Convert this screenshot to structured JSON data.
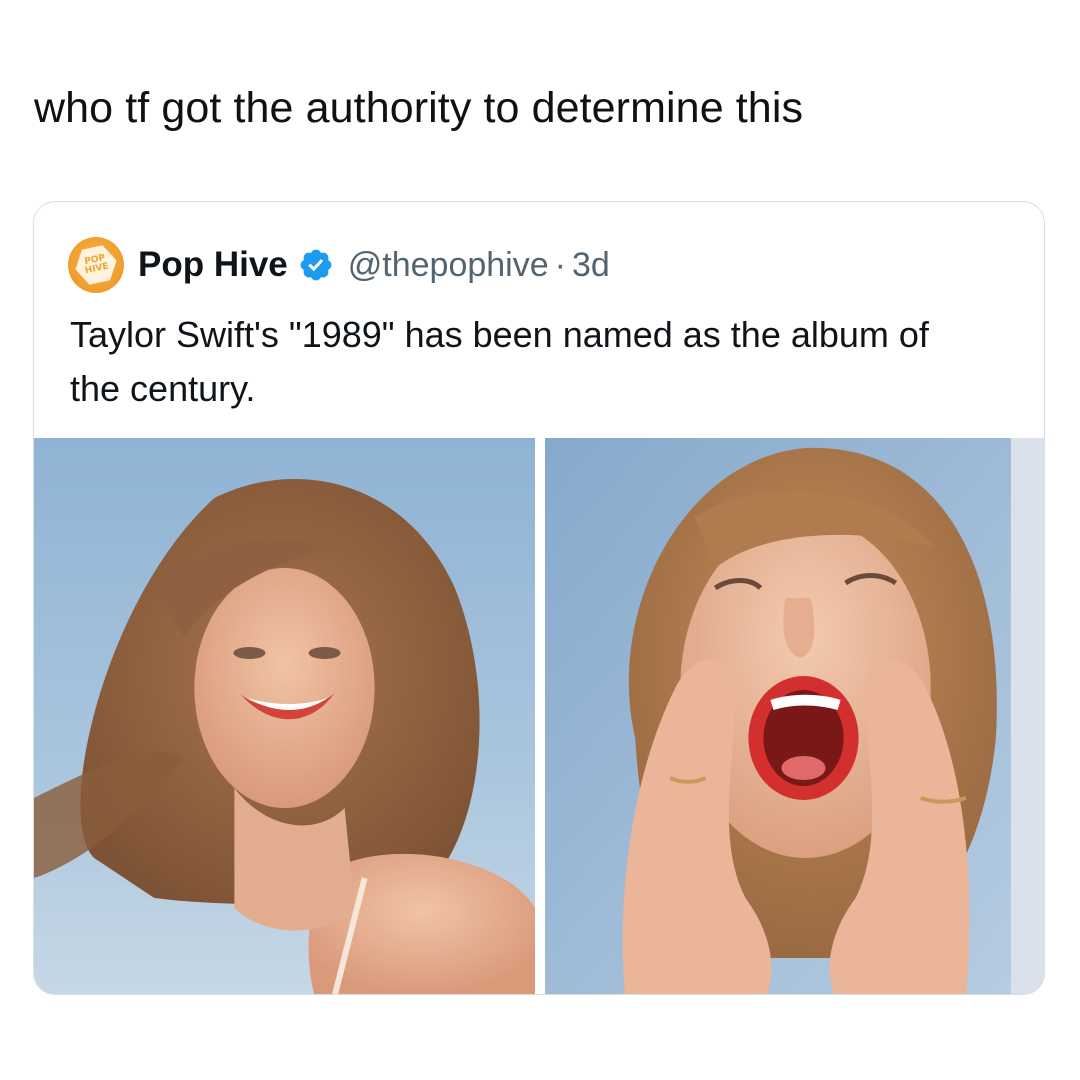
{
  "caption": "who tf got the authority to determine this",
  "quoted_tweet": {
    "avatar_text": [
      "POP",
      "HIVE"
    ],
    "display_name": "Pop Hive",
    "verified": true,
    "handle": "@thepophive",
    "separator": "·",
    "time": "3d",
    "text": "Taylor Swift's \"1989\" has been named as the album of the century.",
    "photos": [
      {
        "icon": "photo-woman-smiling"
      },
      {
        "icon": "photo-woman-shouting"
      }
    ]
  },
  "colors": {
    "accent": "#1d9bf0",
    "avatar": "#f0a233",
    "secondary_text": "#536471",
    "border": "#d8dde1"
  }
}
